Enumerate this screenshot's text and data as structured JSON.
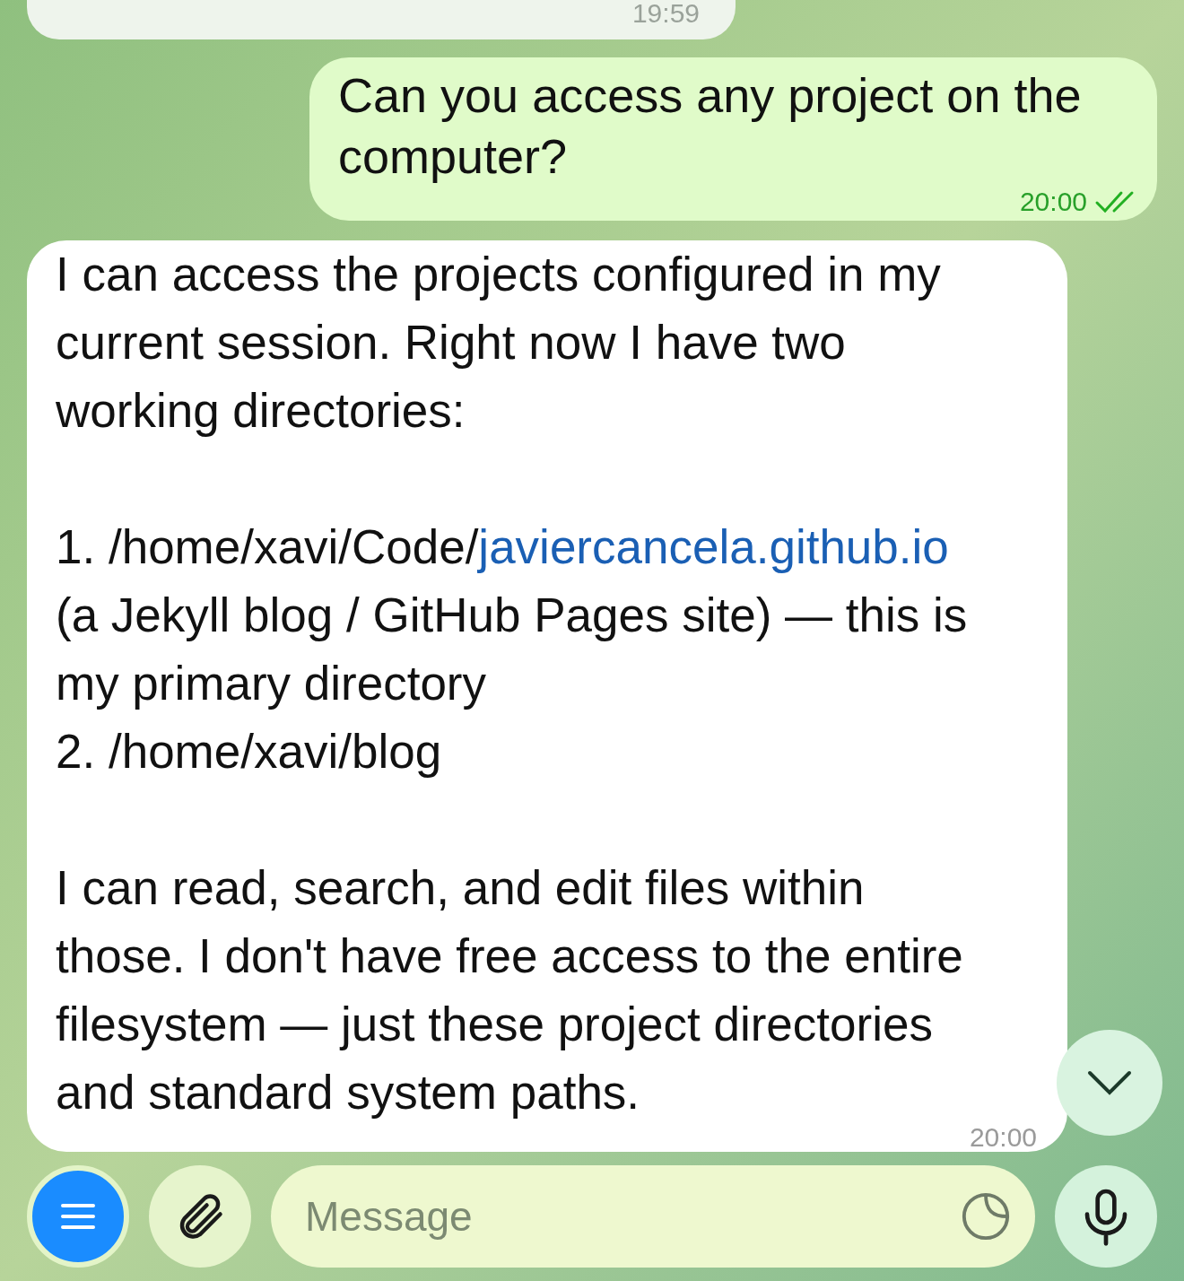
{
  "messages": [
    {
      "kind": "stub",
      "time": "19:59"
    },
    {
      "kind": "outgoing",
      "text": "Can you access any project on the computer?",
      "time": "20:00",
      "read": true
    },
    {
      "kind": "incoming",
      "time": "20:00",
      "blocks": [
        {
          "kind": "paragraph",
          "text": "I can access the projects configured in my current session. Right now I have two working directories:"
        },
        {
          "kind": "list",
          "items": [
            {
              "prefix": "1. /home/xavi/Code/",
              "link": "javiercancela.github.io",
              "suffix": " (a Jekyll blog / GitHub Pages site) — this is my primary directory"
            },
            {
              "prefix": "2. /home/xavi/blog"
            }
          ]
        },
        {
          "kind": "paragraph",
          "text": "I can read, search, and edit files within those. I don't have free access to the entire filesystem — just these project directories and standard system paths."
        }
      ]
    }
  ],
  "composer": {
    "placeholder": "Message"
  }
}
